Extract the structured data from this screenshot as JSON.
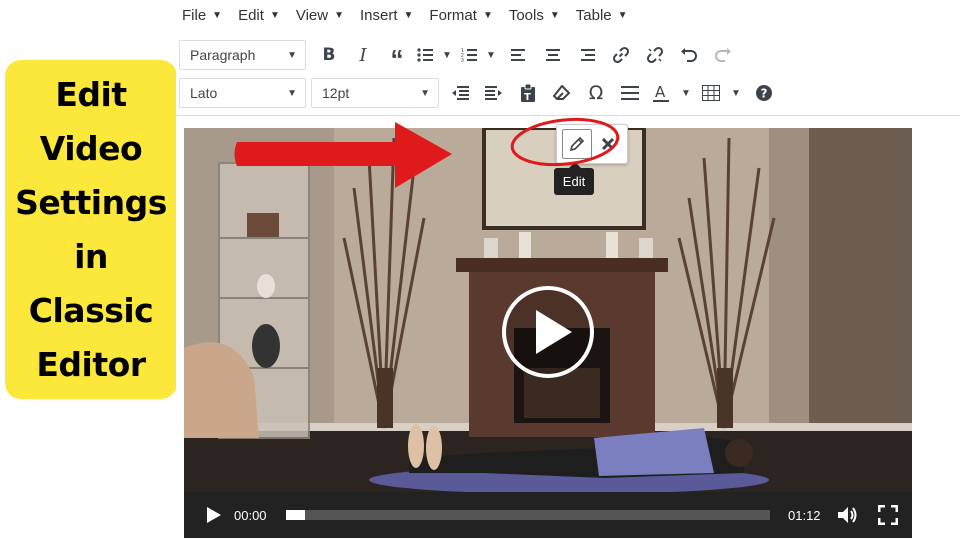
{
  "callout": {
    "text": "Edit\nVideo\nSettings\nin\nClassic\nEditor",
    "background": "#fce83a"
  },
  "menubar": {
    "items": [
      {
        "label": "File"
      },
      {
        "label": "Edit"
      },
      {
        "label": "View"
      },
      {
        "label": "Insert"
      },
      {
        "label": "Format"
      },
      {
        "label": "Tools"
      },
      {
        "label": "Table"
      }
    ]
  },
  "toolbar": {
    "block_format": "Paragraph",
    "font_family": "Lato",
    "font_size": "12pt",
    "row1_icons": [
      "bold-icon",
      "italic-icon",
      "blockquote-icon",
      "bullet-list-icon",
      "numbered-list-icon",
      "align-left-icon",
      "align-center-icon",
      "align-right-icon",
      "link-icon",
      "unlink-icon",
      "undo-icon",
      "redo-icon"
    ],
    "row2_icons": [
      "outdent-icon",
      "indent-icon",
      "paste-as-text-icon",
      "clear-formatting-icon",
      "special-character-icon",
      "horizontal-line-icon",
      "text-color-icon",
      "table-icon",
      "help-icon"
    ]
  },
  "video_toolbar": {
    "tooltip": "Edit"
  },
  "player": {
    "current_time": "00:00",
    "duration": "01:12",
    "progress_fraction": 0.04
  },
  "colors": {
    "annotation_red": "#e0191b",
    "player_bar": "#222222"
  }
}
